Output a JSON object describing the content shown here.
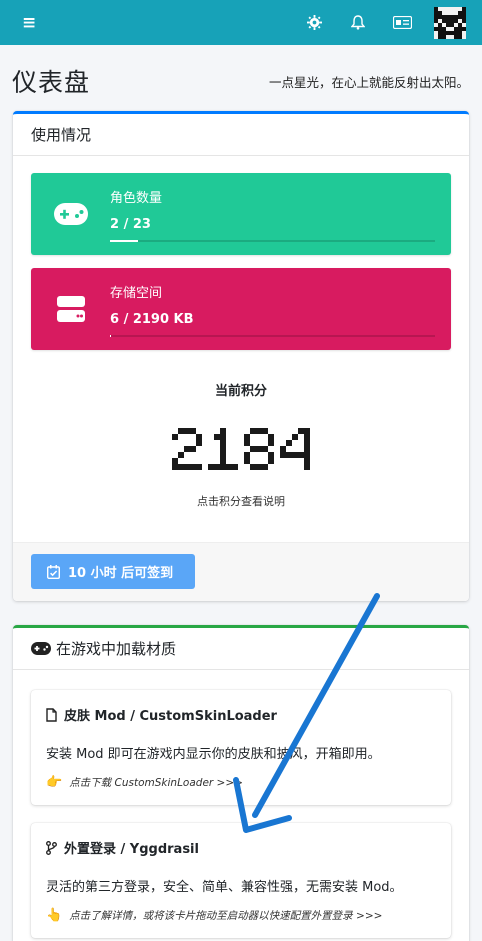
{
  "navbar": {
    "menu_glyph": "≡",
    "icons": [
      "menu-icon",
      "gear-icon",
      "bell-icon",
      "id-card-icon"
    ]
  },
  "header": {
    "title": "仪表盘",
    "motto": "一点星光，在心上就能反射出太阳。"
  },
  "usage": {
    "title": "使用情况",
    "characters": {
      "label": "角色数量",
      "value": "2 / 23",
      "progress": 0.087,
      "color": "#20c997"
    },
    "storage": {
      "label": "存储空间",
      "value": "6 / 2190 KB",
      "progress": 0.003,
      "color": "#d81b60"
    },
    "score_title": "当前积分",
    "score": "2184",
    "score_hint": "点击积分查看说明",
    "checkin_label": "10 小时 后可签到"
  },
  "materials": {
    "title": "在游戏中加载材质",
    "items": [
      {
        "title": "皮肤 Mod / CustomSkinLoader",
        "desc": "安装 Mod 即可在游戏内显示你的皮肤和披风，开箱即用。",
        "link": "点击下载 CustomSkinLoader >>>"
      },
      {
        "title": "外置登录 / Yggdrasil",
        "desc": "灵活的第三方登录，安全、简单、兼容性强，无需安装 Mod。",
        "link": "点击了解详情，或将该卡片拖动至启动器以快速配置外置登录 >>>"
      }
    ]
  },
  "colors": {
    "navbar": "#17a2b8",
    "accent_arrow": "#1976d2"
  }
}
